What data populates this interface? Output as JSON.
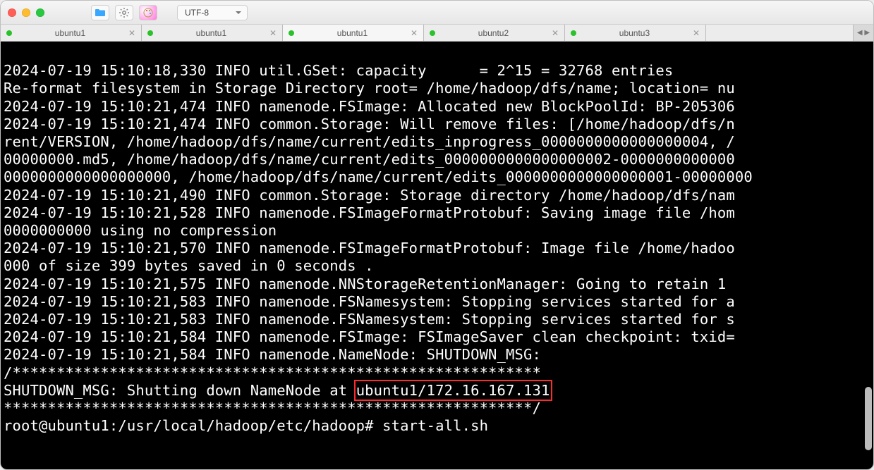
{
  "titlebar": {
    "encoding_label": "UTF-8"
  },
  "tabs": [
    {
      "label": "ubuntu1",
      "active": false
    },
    {
      "label": "ubuntu1",
      "active": false
    },
    {
      "label": "ubuntu1",
      "active": true
    },
    {
      "label": "ubuntu2",
      "active": false
    },
    {
      "label": "ubuntu3",
      "active": false
    }
  ],
  "terminal": {
    "lines": [
      "2024-07-19 15:10:18,330 INFO util.GSet: capacity      = 2^15 = 32768 entries",
      "Re-format filesystem in Storage Directory root= /home/hadoop/dfs/name; location= nu",
      "2024-07-19 15:10:21,474 INFO namenode.FSImage: Allocated new BlockPoolId: BP-205306",
      "2024-07-19 15:10:21,474 INFO common.Storage: Will remove files: [/home/hadoop/dfs/n",
      "rent/VERSION, /home/hadoop/dfs/name/current/edits_inprogress_0000000000000000004, /",
      "00000000.md5, /home/hadoop/dfs/name/current/edits_0000000000000000002-0000000000000",
      "0000000000000000000, /home/hadoop/dfs/name/current/edits_0000000000000000001-00000000",
      "2024-07-19 15:10:21,490 INFO common.Storage: Storage directory /home/hadoop/dfs/nam",
      "2024-07-19 15:10:21,528 INFO namenode.FSImageFormatProtobuf: Saving image file /hom",
      "0000000000 using no compression",
      "2024-07-19 15:10:21,570 INFO namenode.FSImageFormatProtobuf: Image file /home/hadoo",
      "000 of size 399 bytes saved in 0 seconds .",
      "2024-07-19 15:10:21,575 INFO namenode.NNStorageRetentionManager: Going to retain 1 ",
      "2024-07-19 15:10:21,583 INFO namenode.FSNamesystem: Stopping services started for a",
      "2024-07-19 15:10:21,583 INFO namenode.FSNamesystem: Stopping services started for s",
      "2024-07-19 15:10:21,584 INFO namenode.FSImage: FSImageSaver clean checkpoint: txid=",
      "2024-07-19 15:10:21,584 INFO namenode.NameNode: SHUTDOWN_MSG:",
      "/************************************************************"
    ],
    "shutdown_prefix": "SHUTDOWN_MSG: Shutting down NameNode at ",
    "shutdown_highlight": "ubuntu1/172.16.167.131",
    "after_shutdown": "************************************************************/",
    "prompt": "root@ubuntu1:/usr/local/hadoop/etc/hadoop# start-all.sh"
  }
}
